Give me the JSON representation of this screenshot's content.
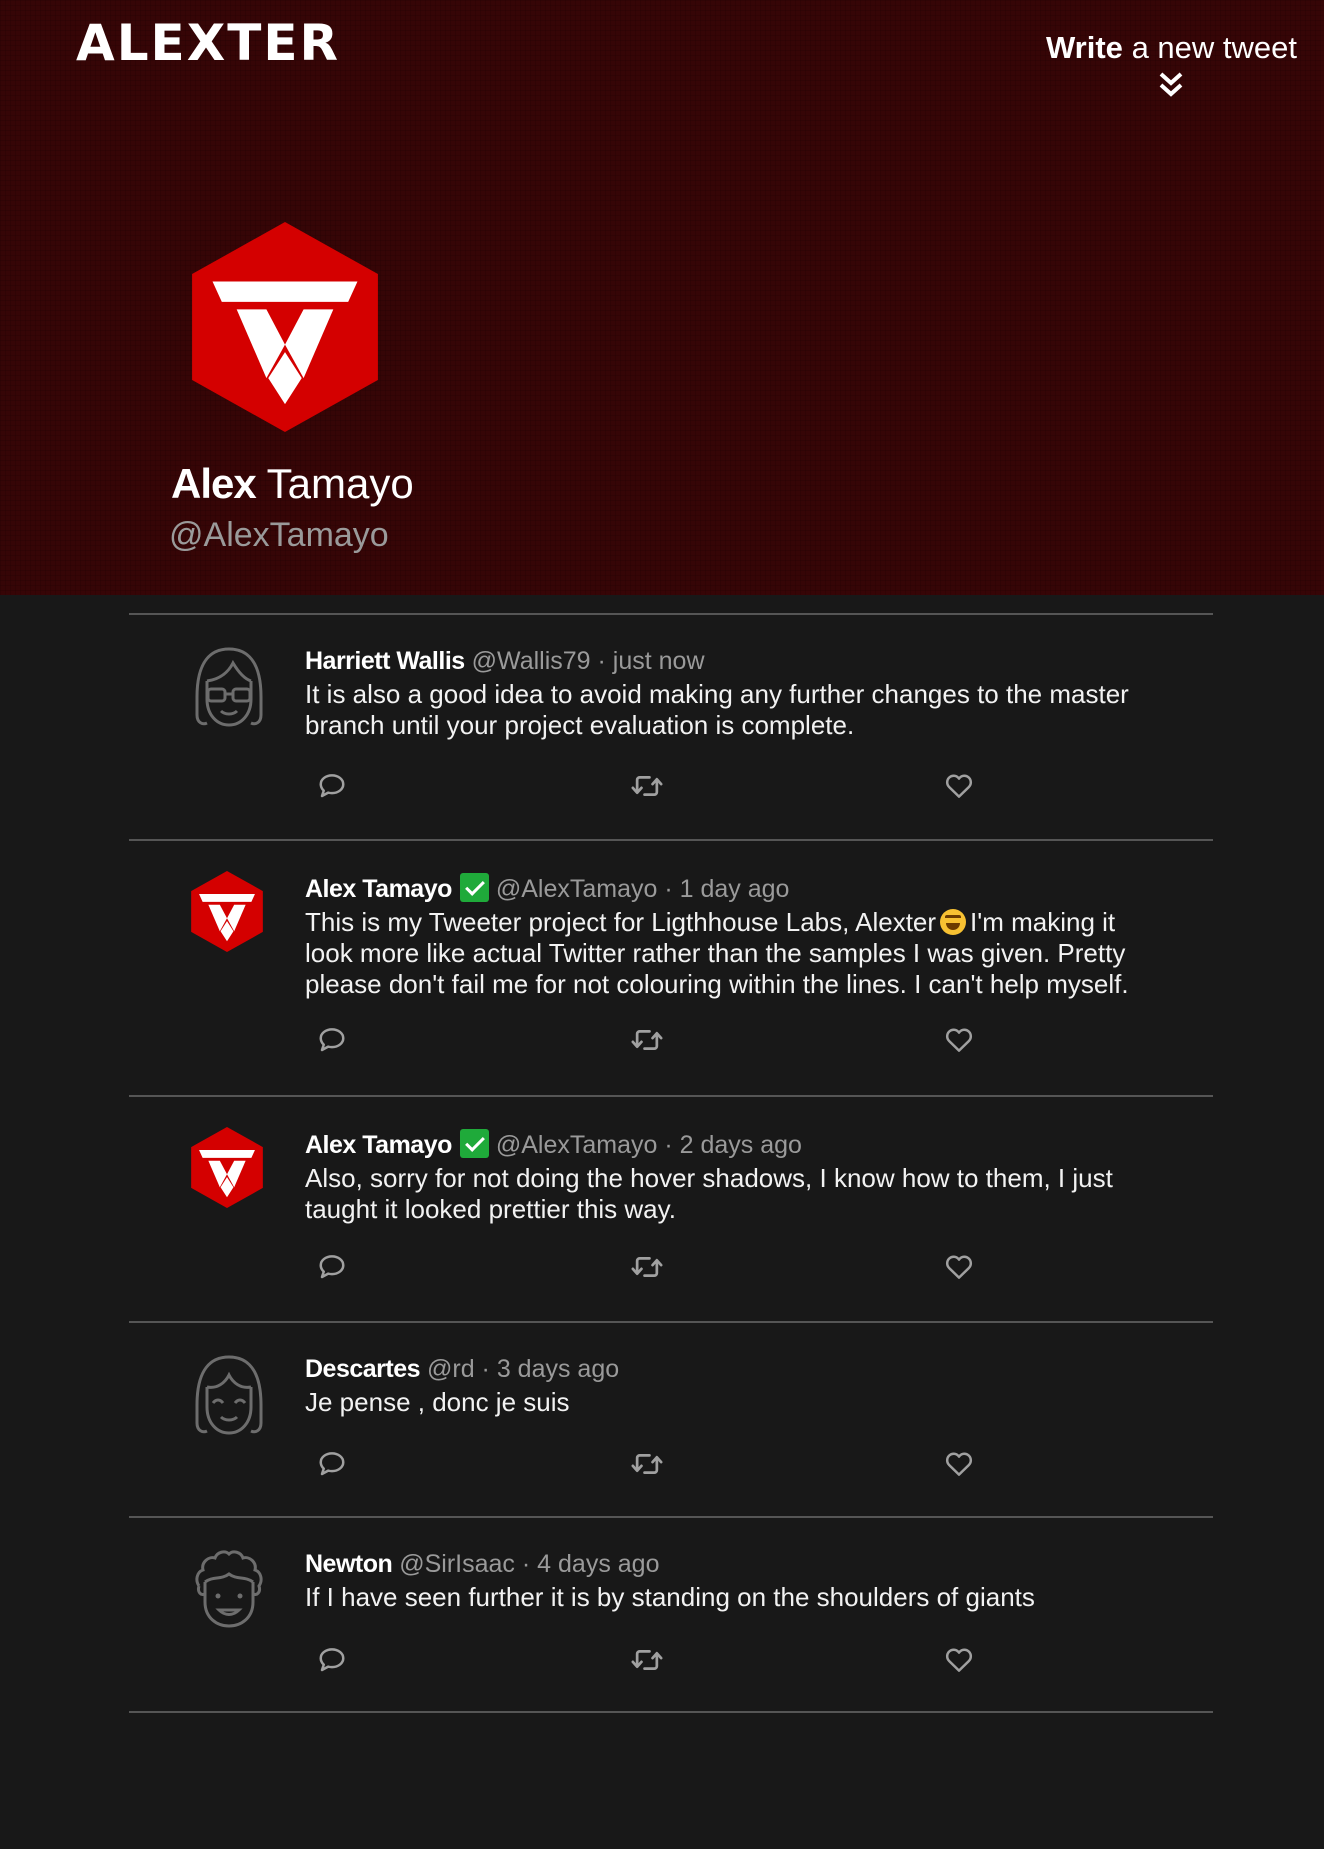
{
  "brand": "ALEXTER",
  "header": {
    "write_bold": "Write",
    "write_rest": "a new tweet"
  },
  "profile": {
    "first_name": "Alex",
    "last_name": "Tamayo",
    "handle": "@AlexTamayo"
  },
  "colors": {
    "header_bg": "#360506",
    "page_bg": "#181818",
    "logo_red": "#d40000",
    "verified_green": "#1faa3a",
    "muted_text": "#9a9a9a"
  },
  "tweets": [
    {
      "name": "Harriett Wallis",
      "handle": "@Wallis79",
      "time": "just now",
      "verified": false,
      "avatar": "girl-with-glasses-avatar",
      "text": "It is also a good idea to avoid making any further changes to the master branch until your project evaluation is complete."
    },
    {
      "name": "Alex Tamayo",
      "handle": "@AlexTamayo",
      "time": "1 day ago",
      "verified": true,
      "avatar": "alexter-logo-avatar",
      "text_before_emoji": "This is my Tweeter project for Ligthhouse Labs, Alexter",
      "emoji": "laughing-face-emoji",
      "text_after_emoji": "I'm making it look more like actual Twitter rather than the samples I was given. Pretty please don't fail me for not colouring within the lines. I can't help myself."
    },
    {
      "name": "Alex Tamayo",
      "handle": "@AlexTamayo",
      "time": "2 days ago",
      "verified": true,
      "avatar": "alexter-logo-avatar",
      "text": "Also, sorry for not doing the hover shadows, I know how to them, I just taught it looked prettier this way."
    },
    {
      "name": "Descartes",
      "handle": "@rd",
      "time": "3 days ago",
      "verified": false,
      "avatar": "girl-with-bangs-avatar",
      "text": "Je pense , donc je suis"
    },
    {
      "name": "Newton",
      "handle": "@SirIsaac",
      "time": "4 days ago",
      "verified": false,
      "avatar": "curly-hair-avatar",
      "text": "If I have seen further it is by standing on the shoulders of giants"
    }
  ],
  "icons": {
    "reply": "reply-icon",
    "retweet": "retweet-icon",
    "like": "heart-icon",
    "write": "double-chevron-down-icon"
  }
}
